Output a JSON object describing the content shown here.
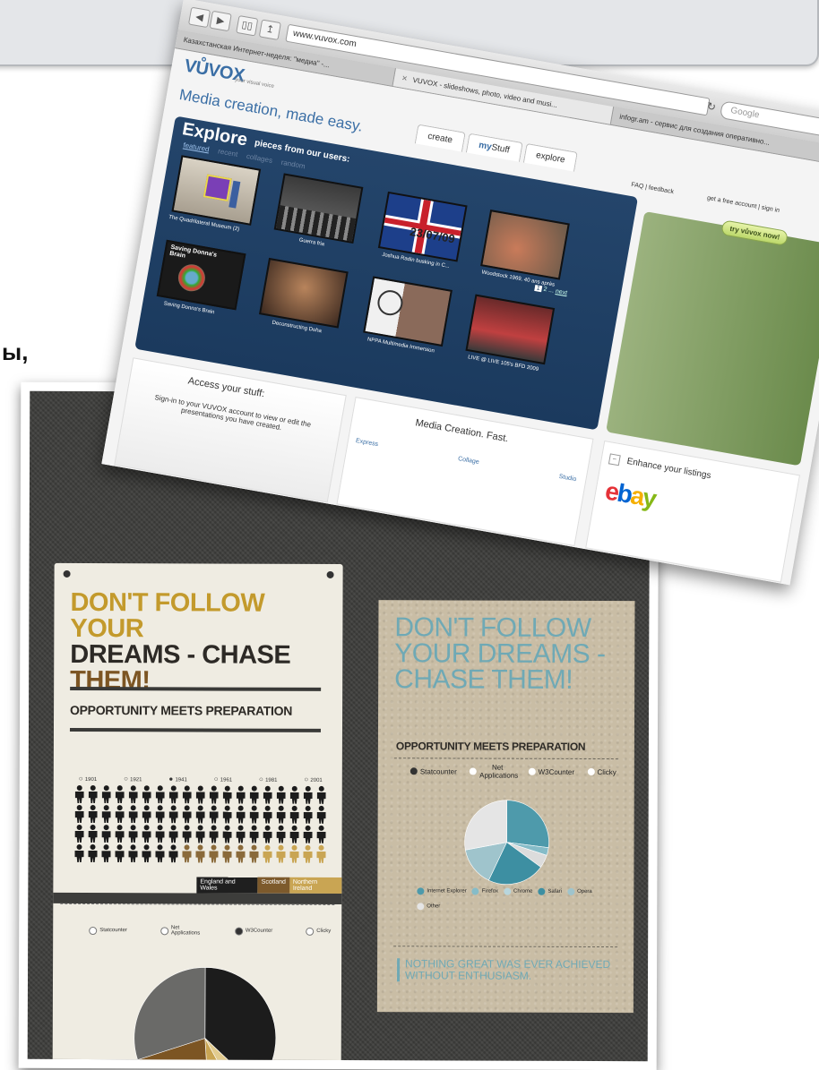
{
  "edge_text": "ы,",
  "browser": {
    "url": "www.vuvox.com",
    "search_placeholder": "Google",
    "tabs": [
      {
        "label": "Казахстанская Интернет-неделя: \"медиа\" -..."
      },
      {
        "label": "VUVOX - slideshows, photo, video and musi..."
      },
      {
        "label": "infogr.am - сервис для создания оперативно..."
      }
    ]
  },
  "site": {
    "logo": "VŮVOX",
    "logo_sub": "your visual voice",
    "tagline": "Media creation, made easy.",
    "nav": {
      "create": "create",
      "my_prefix": "my",
      "my_suffix": "Stuff",
      "explore": "explore"
    },
    "top_links": "FAQ | feedback",
    "top_links2": "get a free account | sign in",
    "try_button": "try vůvox now!",
    "explore": {
      "title": "Explore",
      "subtitle": "pieces from our users:",
      "filters": [
        "featured",
        "recent",
        "collages",
        "random"
      ],
      "pager": {
        "current": "1",
        "rest": "2 ...",
        "next": "next"
      },
      "items": [
        {
          "caption": "The Quadrilateral Museum (2)"
        },
        {
          "caption": "Guerra fria"
        },
        {
          "caption": "Joshua Radin busking in C..."
        },
        {
          "caption": "Woodstock 1969, 40 ans après"
        },
        {
          "caption": "Saving Donna's Brain"
        },
        {
          "caption": "Deconstructing Doha"
        },
        {
          "caption": "NPPA Multimedia Immersion"
        },
        {
          "caption": "LIVE @ LIVE 105's BFD 2009"
        }
      ],
      "thumb_overlay": "23/07/09",
      "thumb_overlay2": "Saving Donna's Brain"
    },
    "access": {
      "title": "Access your stuff:",
      "text": "Sign-in to your VUVOX account to view or edit the presentations you have created."
    },
    "media": {
      "title": "Media Creation. Fast.",
      "tabs": [
        "Express",
        "Collage",
        "Studio"
      ]
    },
    "enhance": {
      "title": "Enhance your listings",
      "ebay": "ebay"
    }
  },
  "infographic": {
    "left": {
      "headline_1": "DON'T FOLLOW YOUR",
      "headline_2": "DREAMS - CHASE",
      "headline_3": "THEM!",
      "subhead": "OPPORTUNITY MEETS PREPARATION",
      "years": [
        "1901",
        "1921",
        "1941",
        "1961",
        "1981",
        "2001"
      ],
      "selected_year_index": 2,
      "legend": [
        "England and Wales",
        "Scotland",
        "Northern Ireland"
      ],
      "radios": [
        "Statcounter",
        "Net Applications",
        "W3Counter",
        "Clicky"
      ],
      "radios_selected_index": 2,
      "pie_colors": [
        "#1c1c1c",
        "#e2cb8e",
        "#c9a553",
        "#7c5523",
        "#6a6a68"
      ],
      "pie_values": [
        0.37,
        0.05,
        0.07,
        0.21,
        0.3
      ]
    },
    "right": {
      "headline": "DON'T FOLLOW YOUR DREAMS - CHASE THEM!",
      "subhead": "OPPORTUNITY MEETS PREPARATION",
      "radios": [
        "Statcounter",
        "Net Applications",
        "W3Counter",
        "Clicky"
      ],
      "radios_selected_index": 0,
      "legend": [
        "Internet Explorer",
        "Firefox",
        "Chrome",
        "Safari",
        "Opera",
        "Other"
      ],
      "legend_colors": [
        "#4e9aab",
        "#86bcc8",
        "#b8d6dd",
        "#3d8fa2",
        "#9fc4cc",
        "#e5e5e5"
      ],
      "pie_colors": [
        "#4e9aab",
        "#86bcc8",
        "#dcdcdc",
        "#3d8fa2",
        "#9fc4cc",
        "#e5e5e5"
      ],
      "pie_values": [
        0.27,
        0.03,
        0.05,
        0.22,
        0.15,
        0.28
      ],
      "quote": "NOTHING GREAT WAS EVER ACHIEVED WITHOUT ENTHUSIASM."
    }
  }
}
